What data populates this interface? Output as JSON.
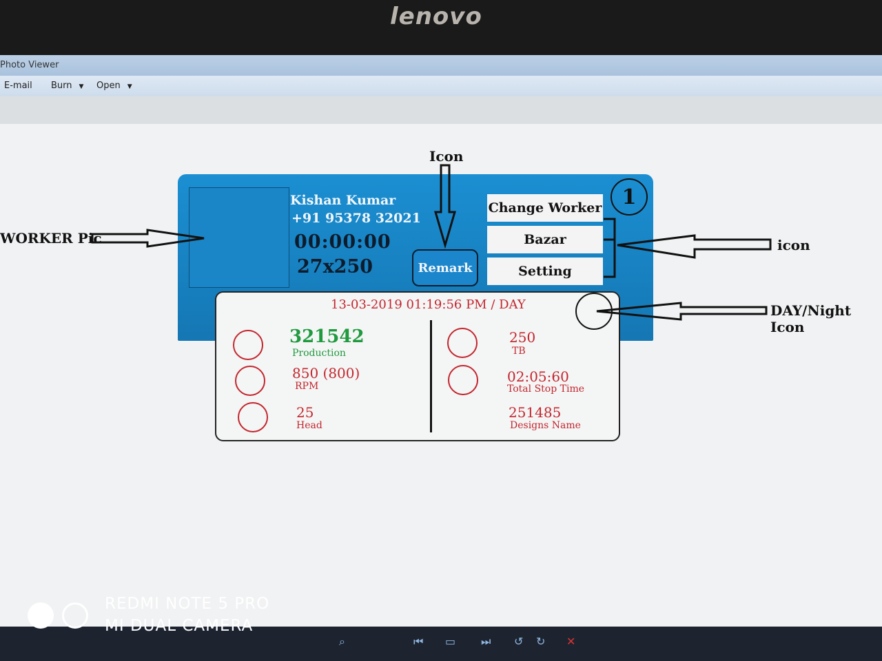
{
  "brand": "lenovo",
  "window": {
    "title": "Photo Viewer"
  },
  "menu": {
    "email": "E-mail",
    "burn": "Burn",
    "open": "Open"
  },
  "worker": {
    "name": "Kishan Kumar",
    "phone": "+91 95378 32021",
    "timer": "00:00:00",
    "size": "27x250"
  },
  "buttons": {
    "remark": "Remark",
    "change_worker": "Change Worker",
    "bazar": "Bazar",
    "setting": "Setting"
  },
  "badge": "1",
  "status": {
    "datetime": "13-03-2019 01:19:56 PM / DAY"
  },
  "stats": {
    "production": {
      "value": "321542",
      "label": "Production"
    },
    "rpm": {
      "value": "850 (800)",
      "label": "RPM"
    },
    "head": {
      "value": "25",
      "label": "Head"
    },
    "tb": {
      "value": "250",
      "label": "TB"
    },
    "stop_time": {
      "value": "02:05:60",
      "label": "Total Stop Time"
    },
    "designs": {
      "value": "251485",
      "label": "Designs Name"
    }
  },
  "annotations": {
    "icon_top": "Icon",
    "worker_pic": "WORKER Pic",
    "icon_right": "icon",
    "day_night": "DAY/Night Icon"
  },
  "camera": {
    "line1": "REDMI NOTE 5 PRO",
    "line2": "MI DUAL CAMERA"
  },
  "colors": {
    "card_blue": "#1b8fd2",
    "stat_red": "#c3262e",
    "production_green": "#1f9a3f"
  }
}
